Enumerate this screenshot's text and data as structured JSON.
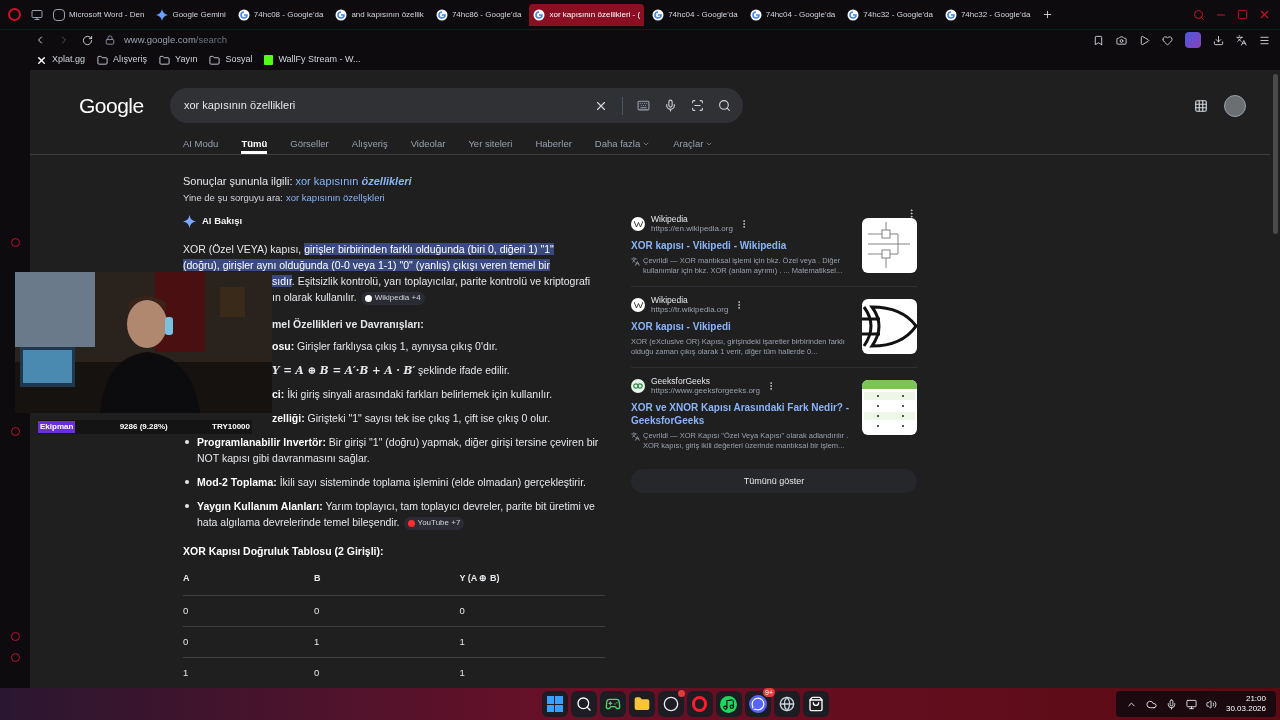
{
  "browser": {
    "tabs": [
      {
        "title": "Microsoft Word - Den",
        "kind": "word",
        "selected": false
      },
      {
        "title": "Google Gemini",
        "kind": "gemini",
        "selected": false
      },
      {
        "title": "74hc08 - Google'da",
        "kind": "google",
        "selected": false
      },
      {
        "title": "and kapısının özellik",
        "kind": "google",
        "selected": false
      },
      {
        "title": "74hc86 - Google'da",
        "kind": "google",
        "selected": false
      },
      {
        "title": "xor kapısının özellikleri - (",
        "kind": "google",
        "selected": true
      },
      {
        "title": "74hc04 - Google'da",
        "kind": "google",
        "selected": false
      },
      {
        "title": "74hc04 - Google'da",
        "kind": "google",
        "selected": false
      },
      {
        "title": "74hc32 - Google'da",
        "kind": "google",
        "selected": false
      },
      {
        "title": "74hc32 - Google'da",
        "kind": "google",
        "selected": false
      }
    ],
    "address": {
      "host": "www.google.com",
      "path": "/search"
    },
    "bookmarks": [
      {
        "label": "Xplat.gg",
        "kind": "site"
      },
      {
        "label": "Alışveriş",
        "kind": "folder"
      },
      {
        "label": "Yayın",
        "kind": "folder"
      },
      {
        "label": "Sosyal",
        "kind": "folder"
      },
      {
        "label": "WallFy Stream - W...",
        "kind": "stream"
      }
    ]
  },
  "google": {
    "logo": "Google",
    "query": "xor kapısının özellikleri",
    "nav": [
      {
        "label": "AI Modu",
        "selected": false,
        "dropdown": false
      },
      {
        "label": "Tümü",
        "selected": true,
        "dropdown": false
      },
      {
        "label": "Görseller",
        "selected": false,
        "dropdown": false
      },
      {
        "label": "Alışveriş",
        "selected": false,
        "dropdown": false
      },
      {
        "label": "Videolar",
        "selected": false,
        "dropdown": false
      },
      {
        "label": "Yer siteleri",
        "selected": false,
        "dropdown": false
      },
      {
        "label": "Haberler",
        "selected": false,
        "dropdown": false
      },
      {
        "label": "Daha fazla",
        "selected": false,
        "dropdown": true
      },
      {
        "label": "Araçlar",
        "selected": false,
        "dropdown": true
      }
    ],
    "correction": {
      "prefix": "Sonuçlar şununla ilgili:",
      "link": "xor kapısının **özellikleri**"
    },
    "search_instead": {
      "prefix": "Yine de şu sorguyu ara:",
      "link": "xor kapısının özellşkleri"
    },
    "ai_overview": {
      "title": "AI Bakışı",
      "lines": [
        {
          "covered": false,
          "parts": [
            {
              "text": "XOR (Özel VEYA) kapısı, ",
              "highlighted": false
            },
            {
              "text": "girişler birbirinden farklı olduğunda (biri 0, diğeri 1) \"1\"",
              "highlighted": true
            }
          ]
        },
        {
          "covered": false,
          "parts": [
            {
              "text": "(doğru), girişler aynı olduğunda (0-0 veya 1-1) \"0\" (yanlış) çıkışı veren temel bir",
              "highlighted": true
            }
          ]
        },
        {
          "covered": true,
          "parts": [
            {
              "text": "sıdır",
              "highlighted": true
            },
            {
              "text": ". Eşitsizlik kontrolü, yarı toplayıcılar, parite kontrolü ve kriptografi",
              "highlighted": false
            }
          ]
        },
        {
          "covered": true,
          "parts": [
            {
              "text": "ın olarak kullanılır.",
              "highlighted": false
            }
          ],
          "chip": {
            "label": "Wikipedia +4",
            "kind": "wikipedia"
          }
        }
      ],
      "heading": {
        "text": "mel Özellikleri ve Davranışları:",
        "covered": true
      },
      "items": [
        {
          "kind": "text",
          "covered": true,
          "term": "osu:",
          "text": " Girişler farklıysa çıkış 1, aynıysa çıkış 0'dır."
        },
        {
          "kind": "math",
          "covered": true,
          "term": "Y = A ⊕ B = A′·B + A · B′",
          "text": " şeklinde ifade edilir."
        },
        {
          "kind": "text",
          "covered": true,
          "term": "ci:",
          "text": " İki giriş sinyali arasındaki farkları belirlemek için kullanılır."
        },
        {
          "kind": "text",
          "covered": true,
          "term": "zelliği:",
          "text": " Girişteki \"1\" sayısı tek ise çıkış 1, çift ise çıkış 0 olur."
        },
        {
          "kind": "text",
          "covered": false,
          "term": "Programlanabilir Invertör:",
          "text": " Bir girişi \"1\" (doğru) yapmak, diğer girişi tersine çeviren bir NOT kapısı gibi davranmasını sağlar."
        },
        {
          "kind": "text",
          "covered": false,
          "term": "Mod-2 Toplama:",
          "text": " İkili sayı sisteminde toplama işlemini (elde olmadan) gerçekleştirir."
        },
        {
          "kind": "text",
          "covered": false,
          "term": "Yaygın Kullanım Alanları:",
          "text": " Yarım toplayıcı, tam toplayıcı devreler, parite bit üretimi ve hata algılama devrelerinde temel bileşendir.",
          "chip": {
            "label": "YouTube +7",
            "kind": "youtube"
          }
        }
      ],
      "table": {
        "title": "XOR Kapısı Doğruluk Tablosu (2 Girişli):",
        "columns": [
          "A",
          "B",
          "Y (A ⊕ B)"
        ],
        "rows": [
          [
            "0",
            "0",
            "0"
          ],
          [
            "0",
            "1",
            "1"
          ],
          [
            "1",
            "0",
            "1"
          ]
        ]
      }
    },
    "sources": [
      {
        "site": "Wikipedia",
        "url": "https://en.wikipedia.org",
        "title": "XOR kapısı - Vikipedi - Wikipedia",
        "snippet": "Çevrildi — XOR mantıksal işlemi için bkz. Özel veya . Diğer kullanımlar için bkz. XOR (anlam ayrımı) . ... Matematiksel...",
        "translated": true,
        "favicon": {
          "kind": "wikipedia"
        },
        "thumb": {
          "kind": "circuit"
        }
      },
      {
        "site": "Wikipedia",
        "url": "https://tr.wikipedia.org",
        "title": "XOR kapısı - Vikipedi",
        "snippet": "XOR (eXclusive OR) Kapısı, girişindeki işaretler birbirinden farklı olduğu zaman çıkış olarak 1 verir, diğer tüm hallerde 0...",
        "translated": false,
        "favicon": {
          "kind": "wikipedia"
        },
        "thumb": {
          "kind": "gate"
        }
      },
      {
        "site": "GeeksforGeeks",
        "url": "https://www.geeksforgeeks.org",
        "title": "XOR ve XNOR Kapısı Arasındaki Fark Nedir? - GeeksforGeeks",
        "snippet": "Çevrildi — XOR Kapısı \"Özel Veya Kapısı\" olarak adlandırılır . XOR kapısı, giriş ikili değerleri üzerinde mantıksal bir işlem...",
        "translated": true,
        "favicon": {
          "kind": "gfg"
        },
        "thumb": {
          "kind": "table"
        }
      }
    ],
    "show_all": "Tümünü göster"
  },
  "webcam": {
    "label": "Ekipman",
    "amount": "9286 (9.28%)",
    "target": "TRY10000"
  },
  "taskbar": {
    "apps": [
      {
        "kind": "start"
      },
      {
        "kind": "search"
      },
      {
        "kind": "game"
      },
      {
        "kind": "files"
      },
      {
        "kind": "obs",
        "badge_dot": true
      },
      {
        "kind": "opera"
      },
      {
        "kind": "spotify"
      },
      {
        "kind": "discord",
        "badge": "9+"
      },
      {
        "kind": "steam"
      },
      {
        "kind": "store"
      }
    ],
    "time": "21:00",
    "date": "30.03.2026"
  }
}
